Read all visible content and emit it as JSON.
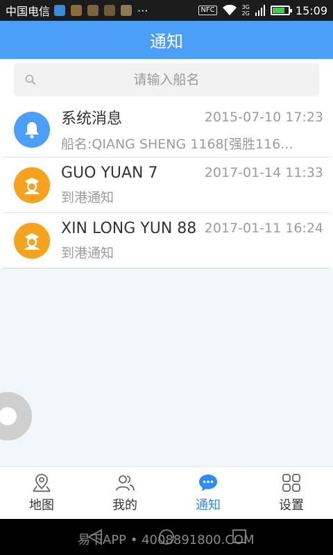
{
  "status_bar": {
    "carrier": "中国电信",
    "dots": "···",
    "nfc": "NFC",
    "net_top": "3G",
    "net_bottom": "2G",
    "time": "15:09"
  },
  "header": {
    "title": "通知"
  },
  "search": {
    "placeholder": "请输入船名"
  },
  "notifications": [
    {
      "title": "系统消息",
      "time": "2015-07-10 17:23",
      "subtitle": "船名:QIANG SHENG 1168[强胜116...",
      "icon": "bell-icon",
      "color": "#4c9ff7"
    },
    {
      "title": "GUO YUAN 7",
      "time": "2017-01-14 11:33",
      "subtitle": "到港通知",
      "icon": "ship-captain-icon",
      "color": "#f5a21e"
    },
    {
      "title": "XIN LONG YUN 88",
      "time": "2017-01-11 16:24",
      "subtitle": "到港通知",
      "icon": "ship-captain-icon",
      "color": "#f5a21e"
    }
  ],
  "tabs": [
    {
      "label": "地图",
      "icon": "map-pin-icon",
      "active": false
    },
    {
      "label": "我的",
      "icon": "users-icon",
      "active": false
    },
    {
      "label": "通知",
      "icon": "chat-bubble-icon",
      "active": true
    },
    {
      "label": "设置",
      "icon": "grid-icon",
      "active": false
    }
  ],
  "watermark": "易下APP • 4008891800.COM",
  "colors": {
    "primary": "#4c9ff7",
    "active_tab": "#2d8cf0",
    "background": "#f0f6fa"
  }
}
